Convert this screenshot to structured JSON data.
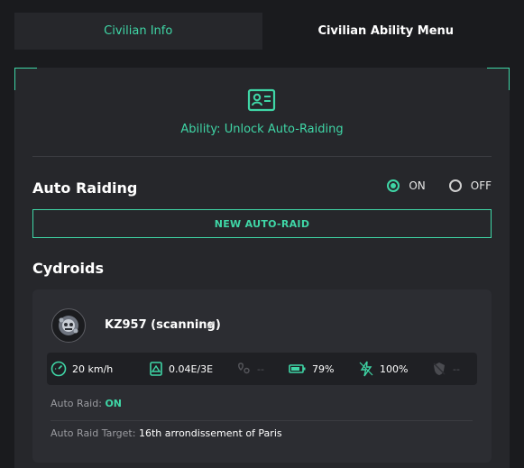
{
  "tabs": {
    "info_label": "Civilian Info",
    "ability_menu_label": "Civilian Ability Menu"
  },
  "ability": {
    "label": "Ability: Unlock Auto-Raiding",
    "icon": "id-card-icon"
  },
  "auto_raiding": {
    "title": "Auto Raiding",
    "on_label": "ON",
    "off_label": "OFF",
    "selected": "ON",
    "new_button_label": "NEW AUTO-RAID"
  },
  "cydroids": {
    "title": "Cydroids",
    "items": [
      {
        "name": "KZ957 (scanning)",
        "stats": {
          "speed": "20 km/h",
          "energy": "0.04E/3E",
          "location": "--",
          "battery": "79%",
          "condition": "100%",
          "other": "--"
        },
        "auto_raid_label": "Auto Raid:",
        "auto_raid_value": "ON",
        "target_label": "Auto Raid Target:",
        "target_value": "16th arrondissement of Paris"
      }
    ]
  },
  "colors": {
    "accent": "#3fd6a6",
    "background": "#1a1b1e",
    "panel": "#26272b",
    "card": "#2c2d32"
  }
}
